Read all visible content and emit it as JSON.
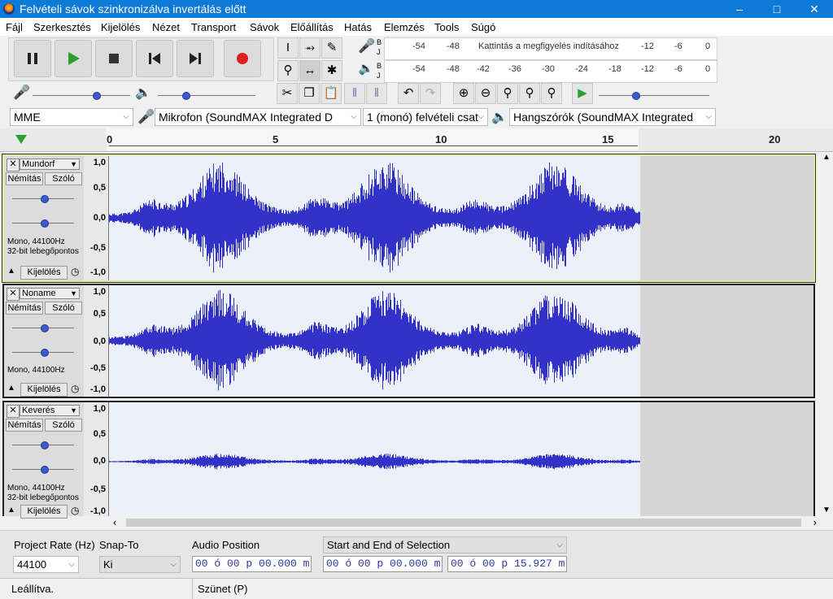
{
  "window": {
    "title": "Felvételi sávok szinkronizálva invertálás előtt"
  },
  "menu": [
    "Fájl",
    "Szerkesztés",
    "Kijelölés",
    "Nézet",
    "Transport",
    "Sávok",
    "Előállítás",
    "Hatás",
    "Elemzés",
    "Tools",
    "Súgó"
  ],
  "meters": {
    "rec_ticks": [
      "-54",
      "-48",
      "-12",
      "-6",
      "0"
    ],
    "rec_message": "Kattintás a megfigyelés indításához",
    "play_ticks": [
      "-54",
      "-48",
      "-42",
      "-36",
      "-30",
      "-24",
      "-18",
      "-12",
      "-6",
      "0"
    ],
    "channel_labels": [
      "B",
      "J"
    ]
  },
  "device": {
    "host": "MME",
    "input": "Mikrofon (SoundMAX Integrated D",
    "channels": "1 (monó) felvételi csat",
    "output": "Hangszórók (SoundMAX Integrated"
  },
  "ruler": {
    "labels": [
      "0",
      "5",
      "10",
      "15",
      "20"
    ]
  },
  "tracks": [
    {
      "name": "Mundorf",
      "mute": "Némítás",
      "solo": "Szóló",
      "info1": "Mono, 44100Hz",
      "info2": "32-bit lebegőpontos",
      "select": "Kijelölés",
      "axis": [
        "1,0",
        "0,5",
        "0,0",
        "-0,5",
        "-1,0"
      ],
      "amplitude": 1.0
    },
    {
      "name": "Noname",
      "mute": "Némítás",
      "solo": "Szóló",
      "info1": "Mono, 44100Hz",
      "info2": "",
      "select": "Kijelölés",
      "axis": [
        "1,0",
        "0,5",
        "0,0",
        "-0,5",
        "-1,0"
      ],
      "amplitude": 1.0
    },
    {
      "name": "Keverés",
      "mute": "Némítás",
      "solo": "Szóló",
      "info1": "Mono, 44100Hz",
      "info2": "32-bit lebegőpontos",
      "select": "Kijelölés",
      "axis": [
        "1,0",
        "0,5",
        "0,0",
        "-0,5",
        "-1,0"
      ],
      "amplitude": 0.15
    }
  ],
  "bottom": {
    "rate_label": "Project Rate (Hz)",
    "rate_value": "44100",
    "snap_label": "Snap-To",
    "snap_value": "Ki",
    "audio_pos_label": "Audio Position",
    "audio_pos_value": "00 ó 00 p 00.000 m",
    "selection_label": "Start and End of Selection",
    "sel_start": "00 ó 00 p 00.000 m",
    "sel_end": "00 ó 00 p 15.927 m"
  },
  "status": {
    "left": "Leállítva.",
    "mid": "Szünet (P)"
  },
  "colors": {
    "wave": "#3232c8",
    "titlebar": "#0d7ad8",
    "selection_bg": "#ebf0fa",
    "record": "#e02020",
    "play": "#2ca02c"
  }
}
